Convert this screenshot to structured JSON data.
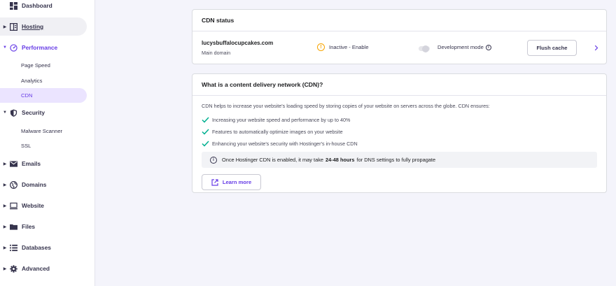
{
  "sidebar": {
    "items": [
      {
        "label": "Dashboard",
        "icon": "dashboard-icon"
      },
      {
        "label": "Hosting",
        "icon": "hosting-icon"
      },
      {
        "label": "Performance",
        "icon": "performance-icon"
      },
      {
        "label": "Security",
        "icon": "shield-icon"
      },
      {
        "label": "Emails",
        "icon": "mail-icon"
      },
      {
        "label": "Domains",
        "icon": "globe-icon"
      },
      {
        "label": "Website",
        "icon": "monitor-icon"
      },
      {
        "label": "Files",
        "icon": "folder-icon"
      },
      {
        "label": "Databases",
        "icon": "database-icon"
      },
      {
        "label": "Advanced",
        "icon": "gear-icon"
      }
    ],
    "performance_sub": [
      "Page Speed",
      "Analytics",
      "CDN"
    ],
    "security_sub": [
      "Malware Scanner",
      "SSL"
    ]
  },
  "cdn_status": {
    "title": "CDN status",
    "domain": "lucysbuffalocupcakes.com",
    "domain_sub": "Main domain",
    "status": "Inactive - Enable",
    "dev_mode_label": "Development mode",
    "flush_label": "Flush cache"
  },
  "what_is": {
    "title": "What is a content delivery network (CDN)?",
    "intro": "CDN helps to increase your website's loading speed by storing copies of your website on servers across the globe. CDN ensures:",
    "features": [
      "Increasing your website speed and performance by up to 40%",
      "Features to automatically optimize images on your website",
      "Enhancing your website's security with Hostinger's in-house CDN"
    ],
    "note_before": "Once Hostinger CDN is enabled, it may take",
    "note_bold": "24-48 hours",
    "note_after": "for DNS settings to fully propagate",
    "learn_more": "Learn more"
  },
  "colors": {
    "accent": "#673de6",
    "check": "#00b090",
    "warning": "#f7a400"
  }
}
